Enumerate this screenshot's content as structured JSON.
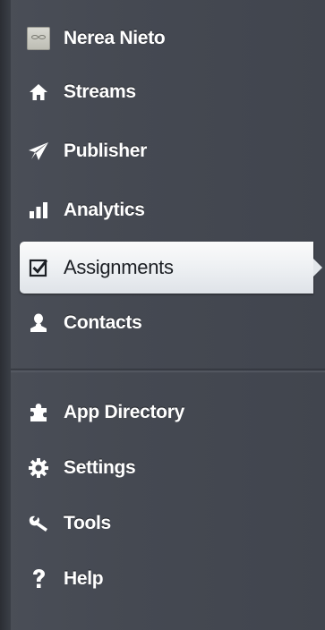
{
  "nav": {
    "items": [
      {
        "label": "Nerea Nieto",
        "icon": "avatar"
      },
      {
        "label": "Streams",
        "icon": "home-icon"
      },
      {
        "label": "Publisher",
        "icon": "paper-plane-icon"
      },
      {
        "label": "Analytics",
        "icon": "bar-chart-icon"
      },
      {
        "label": "Assignments",
        "icon": "checkbox-icon",
        "active": true
      },
      {
        "label": "Contacts",
        "icon": "person-icon"
      },
      {
        "label": "App Directory",
        "icon": "puzzle-icon"
      },
      {
        "label": "Settings",
        "icon": "gear-icon"
      },
      {
        "label": "Tools",
        "icon": "wrench-icon"
      },
      {
        "label": "Help",
        "icon": "question-icon"
      }
    ]
  },
  "colors": {
    "background": "#454952",
    "text": "#ffffff",
    "active_background": "#eceff2",
    "active_text": "#1c1f24"
  }
}
